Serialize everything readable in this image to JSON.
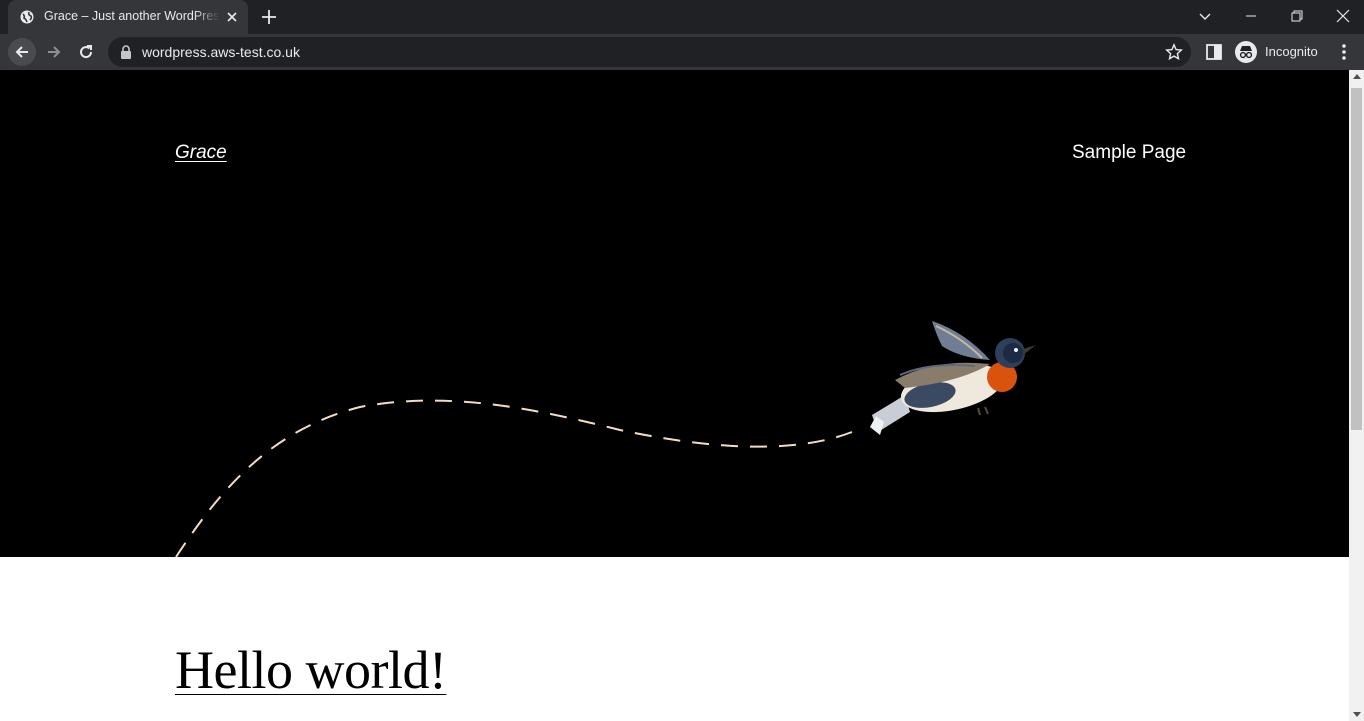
{
  "browser": {
    "tab": {
      "title": "Grace – Just another WordPress site",
      "favicon": "globe-icon"
    },
    "new_tab_icon": "plus-icon",
    "window_controls": [
      "tab-search-icon",
      "minimize-icon",
      "restore-icon",
      "close-icon"
    ],
    "address": {
      "url": "wordpress.aws-test.co.uk",
      "lock_icon": "lock-icon",
      "bookmark_icon": "star-icon"
    },
    "profile": {
      "label": "Incognito",
      "icon": "incognito-icon"
    }
  },
  "page": {
    "site_title": "Grace",
    "nav": [
      "Sample Page"
    ],
    "hero": {
      "background": "#000000",
      "illustration": "bird-icon",
      "path_color": "#f4dcc4"
    },
    "post_title": "Hello world!"
  }
}
